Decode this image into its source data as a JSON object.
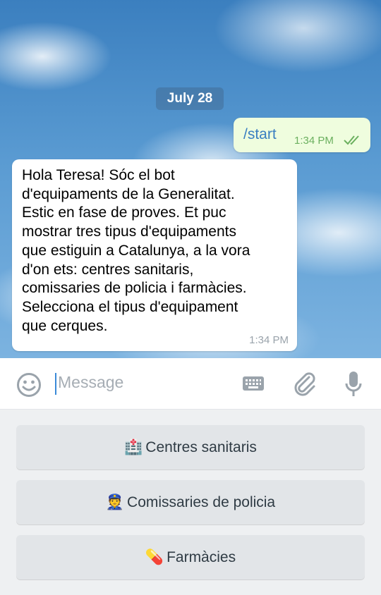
{
  "chat": {
    "date_label": "July 28",
    "outgoing": {
      "text": "/start",
      "time": "1:34 PM",
      "status": "read-double-check"
    },
    "incoming": {
      "text": "Hola Teresa! Sóc el bot\nd'equipaments de la Generalitat.\nEstic en fase de proves.  Et puc\nmostrar tres tipus d'equipaments\nque estiguin a Catalunya, a la vora\nd'on ets: centres sanitaris,\ncomissaries de policia i farmàcies.\nSelecciona el tipus d'equipament\nque cerques.",
      "time": "1:34 PM"
    }
  },
  "input": {
    "placeholder": "Message"
  },
  "icons": {
    "emoji": "smiley-icon",
    "keyboard": "keyboard-icon",
    "attach": "paperclip-icon",
    "mic": "microphone-icon"
  },
  "keyboard_buttons": [
    {
      "emoji": "🏥",
      "label": "Centres sanitaris"
    },
    {
      "emoji": "👮",
      "label": "Comissaries de policia"
    },
    {
      "emoji": "💊",
      "label": "Farmàcies"
    }
  ],
  "colors": {
    "outgoing_bubble": "#effdde",
    "outgoing_text": "#3a7fc1",
    "outgoing_time": "#6bb05f",
    "incoming_bubble": "#ffffff",
    "caret": "#3a8ad8",
    "keyboard_button": "#e2e5e8"
  }
}
